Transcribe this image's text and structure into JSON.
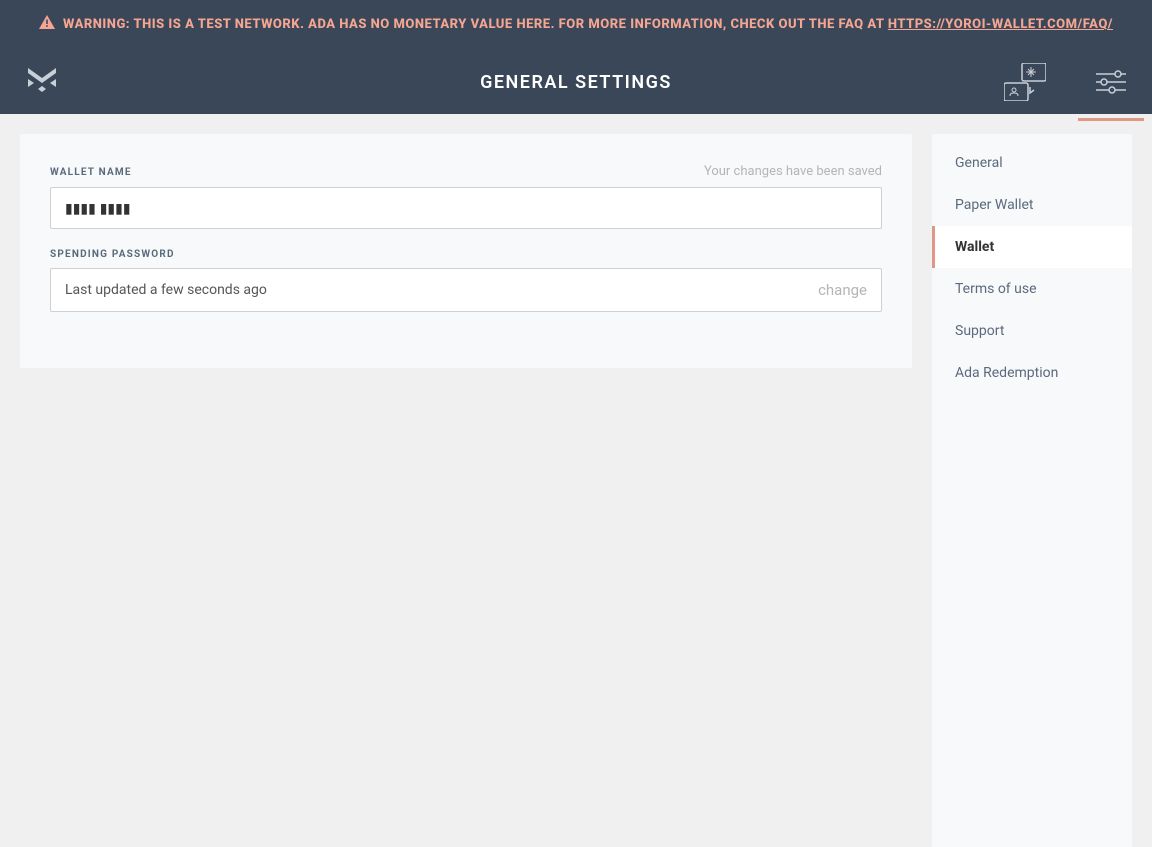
{
  "warning": {
    "text_prefix": "WARNING: THIS IS A TEST NETWORK. ADA HAS NO MONETARY VALUE HERE. FOR MORE INFORMATION, CHECK OUT THE FAQ AT ",
    "link_text": "HTTPS://YOROI-WALLET.COM/FAQ/"
  },
  "header": {
    "title": "GENERAL SETTINGS"
  },
  "form": {
    "wallet_name": {
      "label": "WALLET NAME",
      "saved_msg": "Your changes have been saved",
      "value": "▮▮▮▮ ▮▮▮▮"
    },
    "spending_password": {
      "label": "SPENDING PASSWORD",
      "status": "Last updated a few seconds ago",
      "change_label": "change"
    }
  },
  "sidebar": {
    "items": [
      {
        "label": "General",
        "active": false
      },
      {
        "label": "Paper Wallet",
        "active": false
      },
      {
        "label": "Wallet",
        "active": true
      },
      {
        "label": "Terms of use",
        "active": false
      },
      {
        "label": "Support",
        "active": false
      },
      {
        "label": "Ada Redemption",
        "active": false
      }
    ]
  }
}
